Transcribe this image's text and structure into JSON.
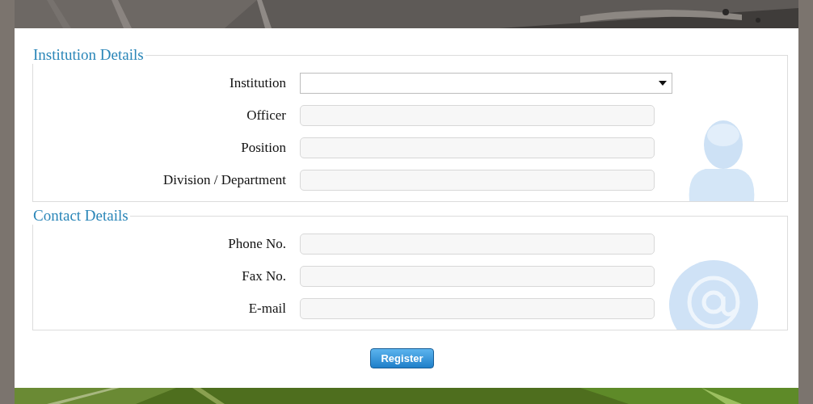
{
  "sections": [
    {
      "legend": "Institution Details",
      "kind": "person",
      "fields": [
        {
          "label": "Institution",
          "kind": "select"
        },
        {
          "label": "Officer",
          "kind": "text"
        },
        {
          "label": "Position",
          "kind": "text"
        },
        {
          "label": "Division / Department",
          "kind": "text"
        }
      ]
    },
    {
      "legend": "Contact Details",
      "kind": "contact",
      "fields": [
        {
          "label": "Phone No.",
          "kind": "text"
        },
        {
          "label": "Fax No.",
          "kind": "text"
        },
        {
          "label": "E-mail",
          "kind": "text"
        }
      ]
    }
  ],
  "button": "Register"
}
